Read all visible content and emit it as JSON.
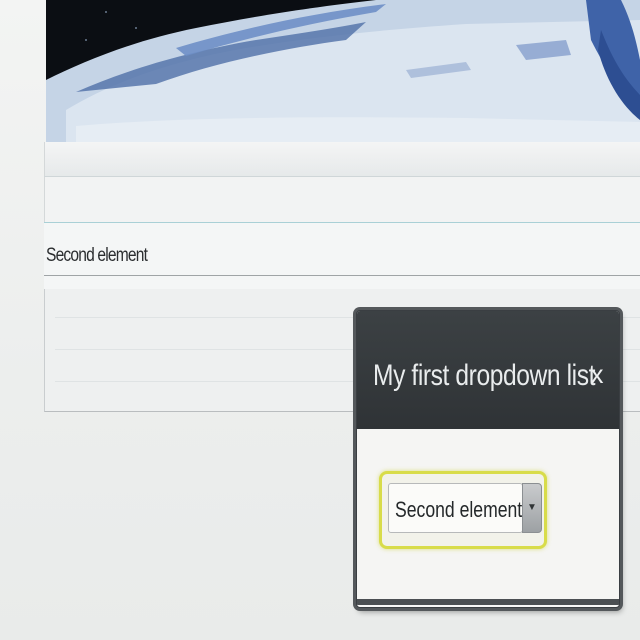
{
  "list": {
    "row_label": "Second element"
  },
  "dialog": {
    "title": "My first dropdown list",
    "close_label": "x",
    "select": {
      "selected_value": "Second element"
    }
  },
  "colors": {
    "dialog_header": "#33373a",
    "select_focus_ring": "#d8dc4a",
    "row_border": "#a9d0d6"
  },
  "icons": {
    "close": "close-icon",
    "dropdown_arrow": "chevron-down-icon"
  }
}
